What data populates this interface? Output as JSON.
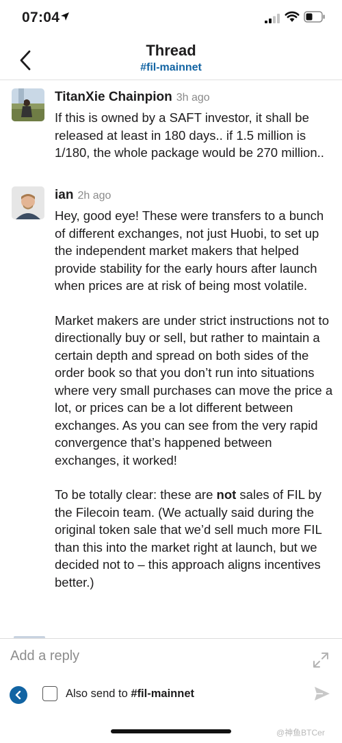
{
  "status_bar": {
    "time": "07:04"
  },
  "nav": {
    "title": "Thread",
    "channel": "#fil-mainnet"
  },
  "messages": [
    {
      "author": "TitanXie Chainpion",
      "time": "3h ago",
      "paragraphs": [
        "If this is owned by a SAFT investor, it shall be released at least in 180 days.. if 1.5 million is 1/180, the whole package would be 270 million.."
      ]
    },
    {
      "author": "ian",
      "time": "2h ago",
      "paragraphs": [
        "Hey, good eye! These were transfers to a bunch of different exchanges, not just Huobi, to set up the independent market makers that helped provide stability for the early hours after launch when prices are at risk of being most volatile.",
        "Market makers are under strict instructions not to directionally buy or sell, but rather to maintain a certain depth and spread on both sides of the order book so that you don’t run into situations where very small purchases can move the price a lot, or prices can be a lot different between exchanges. As you can see from the very rapid convergence that’s happened between exchanges, it worked!"
      ],
      "last_paragraph": {
        "before": "To be totally clear: these are ",
        "bold": "not",
        "after": " sales of FIL by the Filecoin team. (We actually said during the original token sale that we’d sell much more FIL than this into the market right at launch, but we decided not to – this approach aligns incentives better.)"
      }
    }
  ],
  "composer": {
    "placeholder": "Add a reply",
    "also_send_prefix": "Also send to ",
    "also_send_channel": "#fil-mainnet"
  },
  "watermark": "@神鱼BTCer",
  "colors": {
    "link": "#1264a3",
    "text": "#1d1c1d",
    "timestamp": "#8a8a8a"
  },
  "icons": [
    "location-arrow-icon",
    "signal-icon",
    "wifi-icon",
    "battery-icon",
    "back-chevron-icon",
    "expand-icon",
    "collapse-icon",
    "send-icon"
  ]
}
